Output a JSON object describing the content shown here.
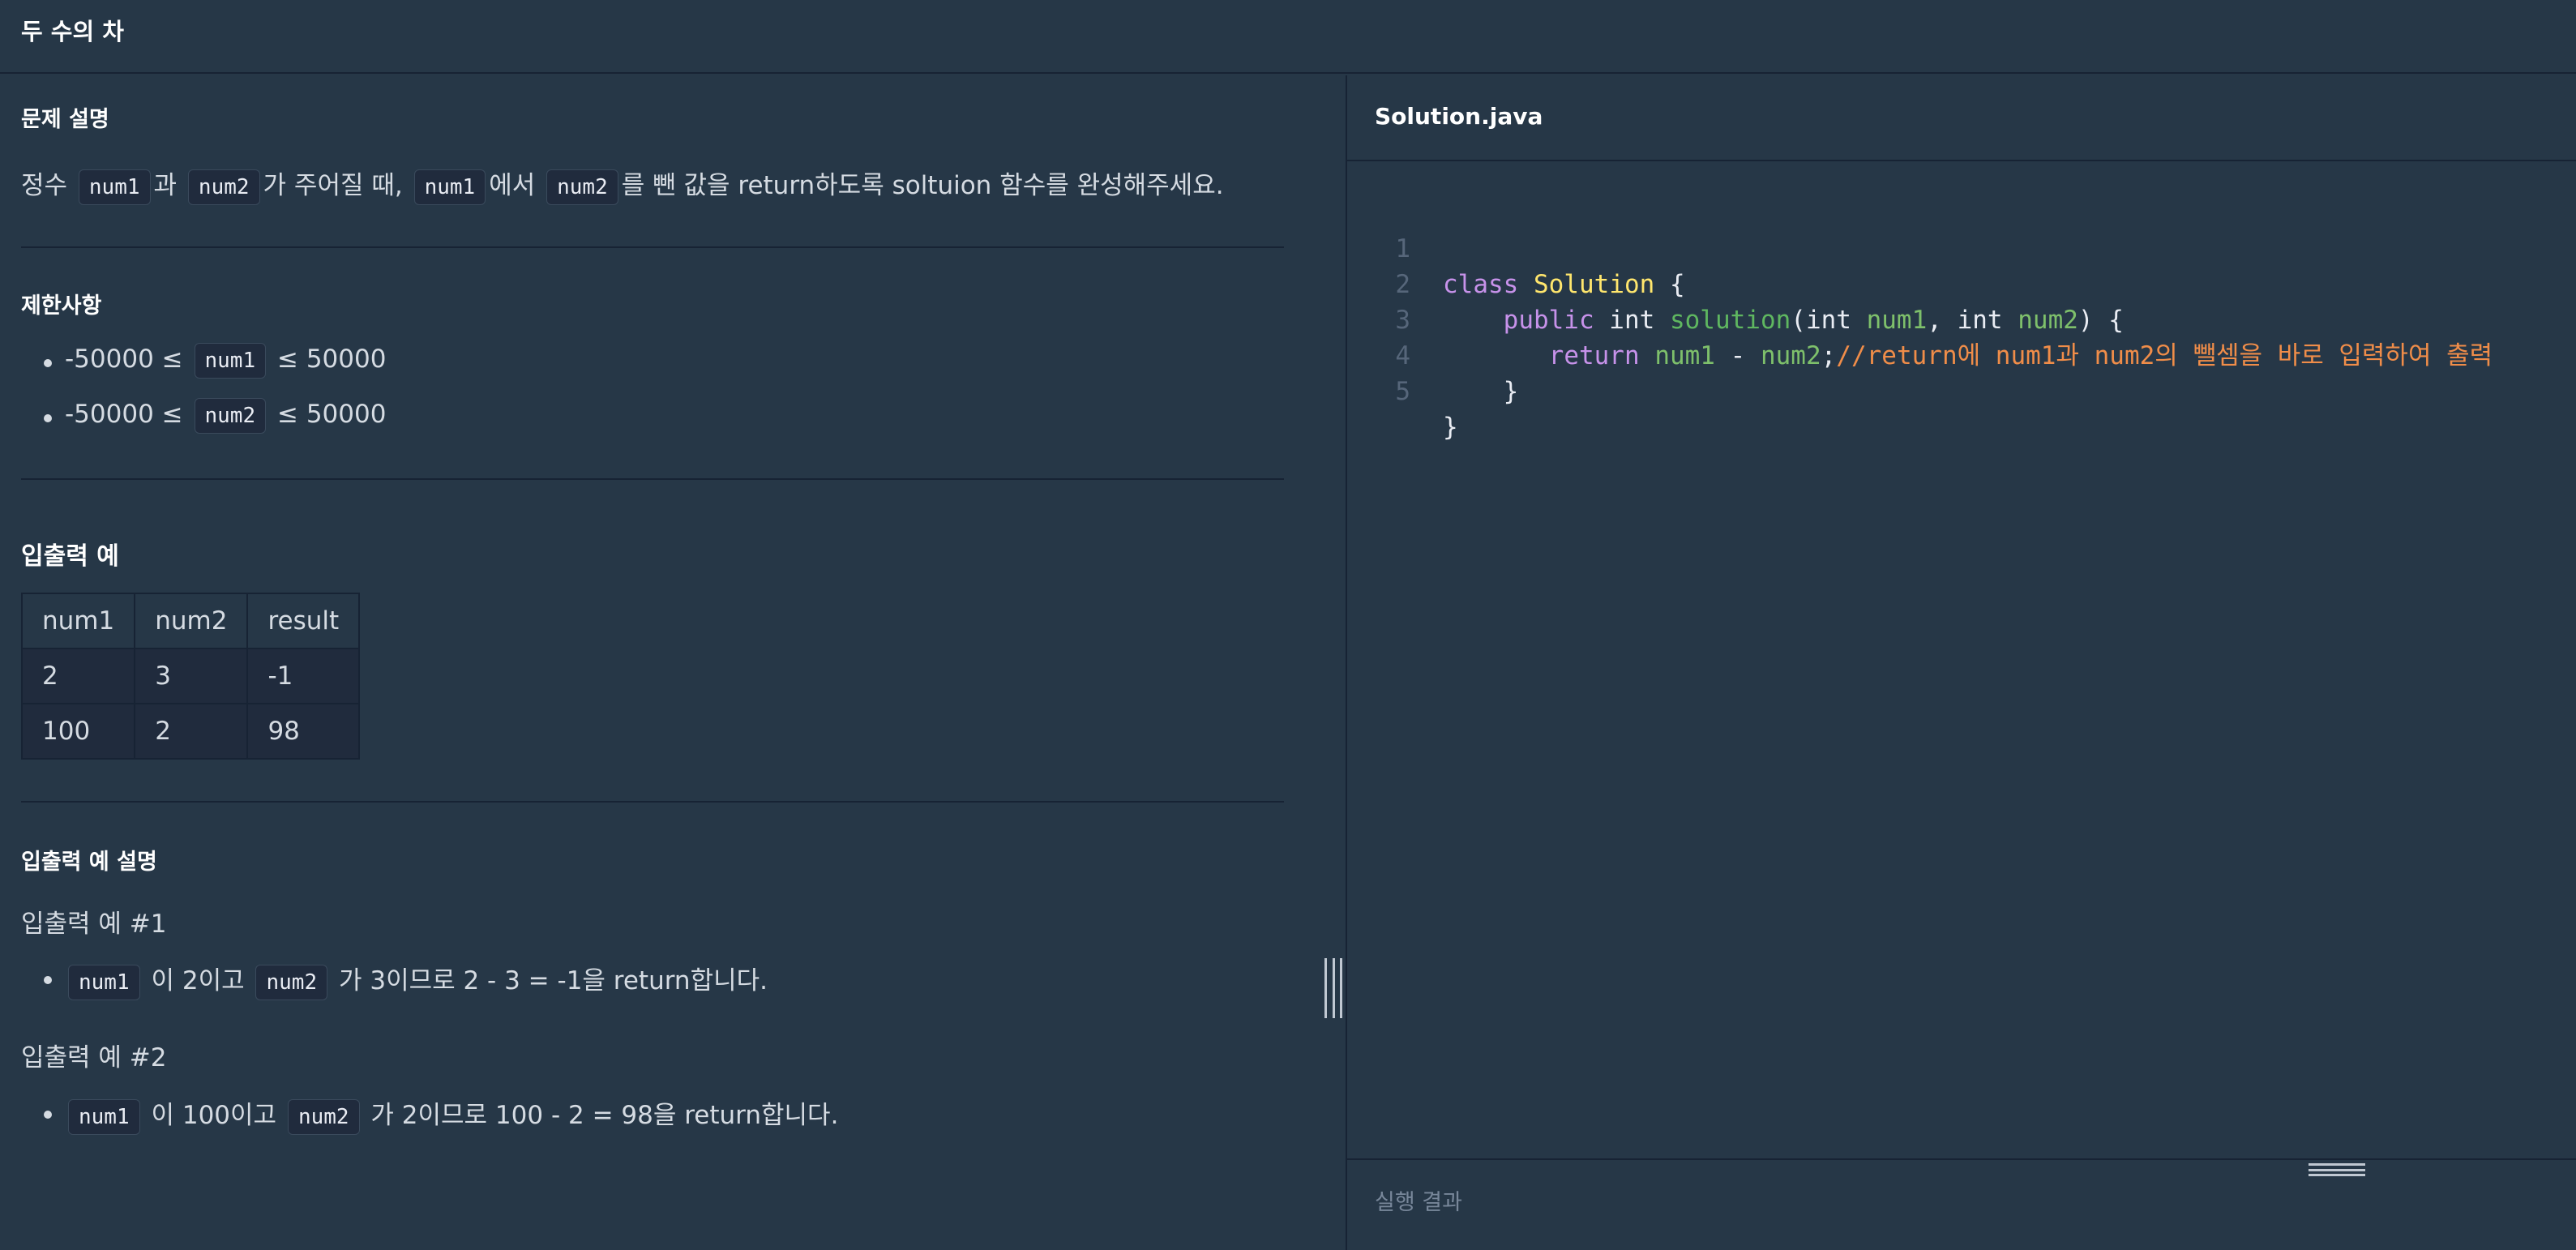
{
  "header": {
    "title": "두 수의 차"
  },
  "problem": {
    "desc_title": "문제 설명",
    "desc": {
      "t1": "정수",
      "c1": "num1",
      "t2": "과",
      "c2": "num2",
      "t3": "가 주어질 때,",
      "c3": "num1",
      "t4": "에서",
      "c4": "num2",
      "t5": "를 뺀 값을 return하도록 soltuion 함수를 완성해주세요."
    },
    "constraints_title": "제한사항",
    "constraints": [
      {
        "pre": "-50000 ≤",
        "code": "num1",
        "post": "≤ 50000"
      },
      {
        "pre": "-50000 ≤",
        "code": "num2",
        "post": "≤ 50000"
      }
    ],
    "io_title": "입출력 예",
    "io_table": {
      "headers": [
        "num1",
        "num2",
        "result"
      ],
      "rows": [
        [
          "2",
          "3",
          "-1"
        ],
        [
          "100",
          "2",
          "98"
        ]
      ]
    },
    "io_desc_title": "입출력 예 설명",
    "examples": [
      {
        "title": "입출력 예 #1",
        "c1": "num1",
        "t1": "이 2이고",
        "c2": "num2",
        "t2": "가 3이므로 2 - 3 = -1을 return합니다."
      },
      {
        "title": "입출력 예 #2",
        "c1": "num1",
        "t1": "이 100이고",
        "c2": "num2",
        "t2": "가 2이므로 100 - 2 = 98을 return합니다."
      }
    ]
  },
  "editor": {
    "filename": "Solution.java",
    "line_numbers": [
      "1",
      "2",
      "3",
      "4",
      "5"
    ],
    "lines": {
      "l1": {
        "kw": "class",
        "cls": "Solution",
        "rest": " {"
      },
      "l2": {
        "indent": "    ",
        "kw": "public",
        "t1": " int ",
        "fn": "solution",
        "t2": "(int ",
        "v1": "num1",
        "t3": ", int ",
        "v2": "num2",
        "t4": ") {"
      },
      "l3": {
        "indent": "       ",
        "kw": "return",
        "sp": " ",
        "v1": "num1",
        "op": " - ",
        "v2": "num2",
        "semi": ";",
        "cmt": "//return에 num1과 num2의 뺄셈을 바로 입력하여 출력"
      },
      "l4": {
        "text": "    }"
      },
      "l5": {
        "text": "}"
      }
    }
  },
  "result": {
    "label": "실행 결과"
  },
  "colors": {
    "background": "#263747",
    "keyword": "#c792ea",
    "class": "#ffe66d",
    "function": "#5fb760",
    "comment": "#f08d49"
  }
}
